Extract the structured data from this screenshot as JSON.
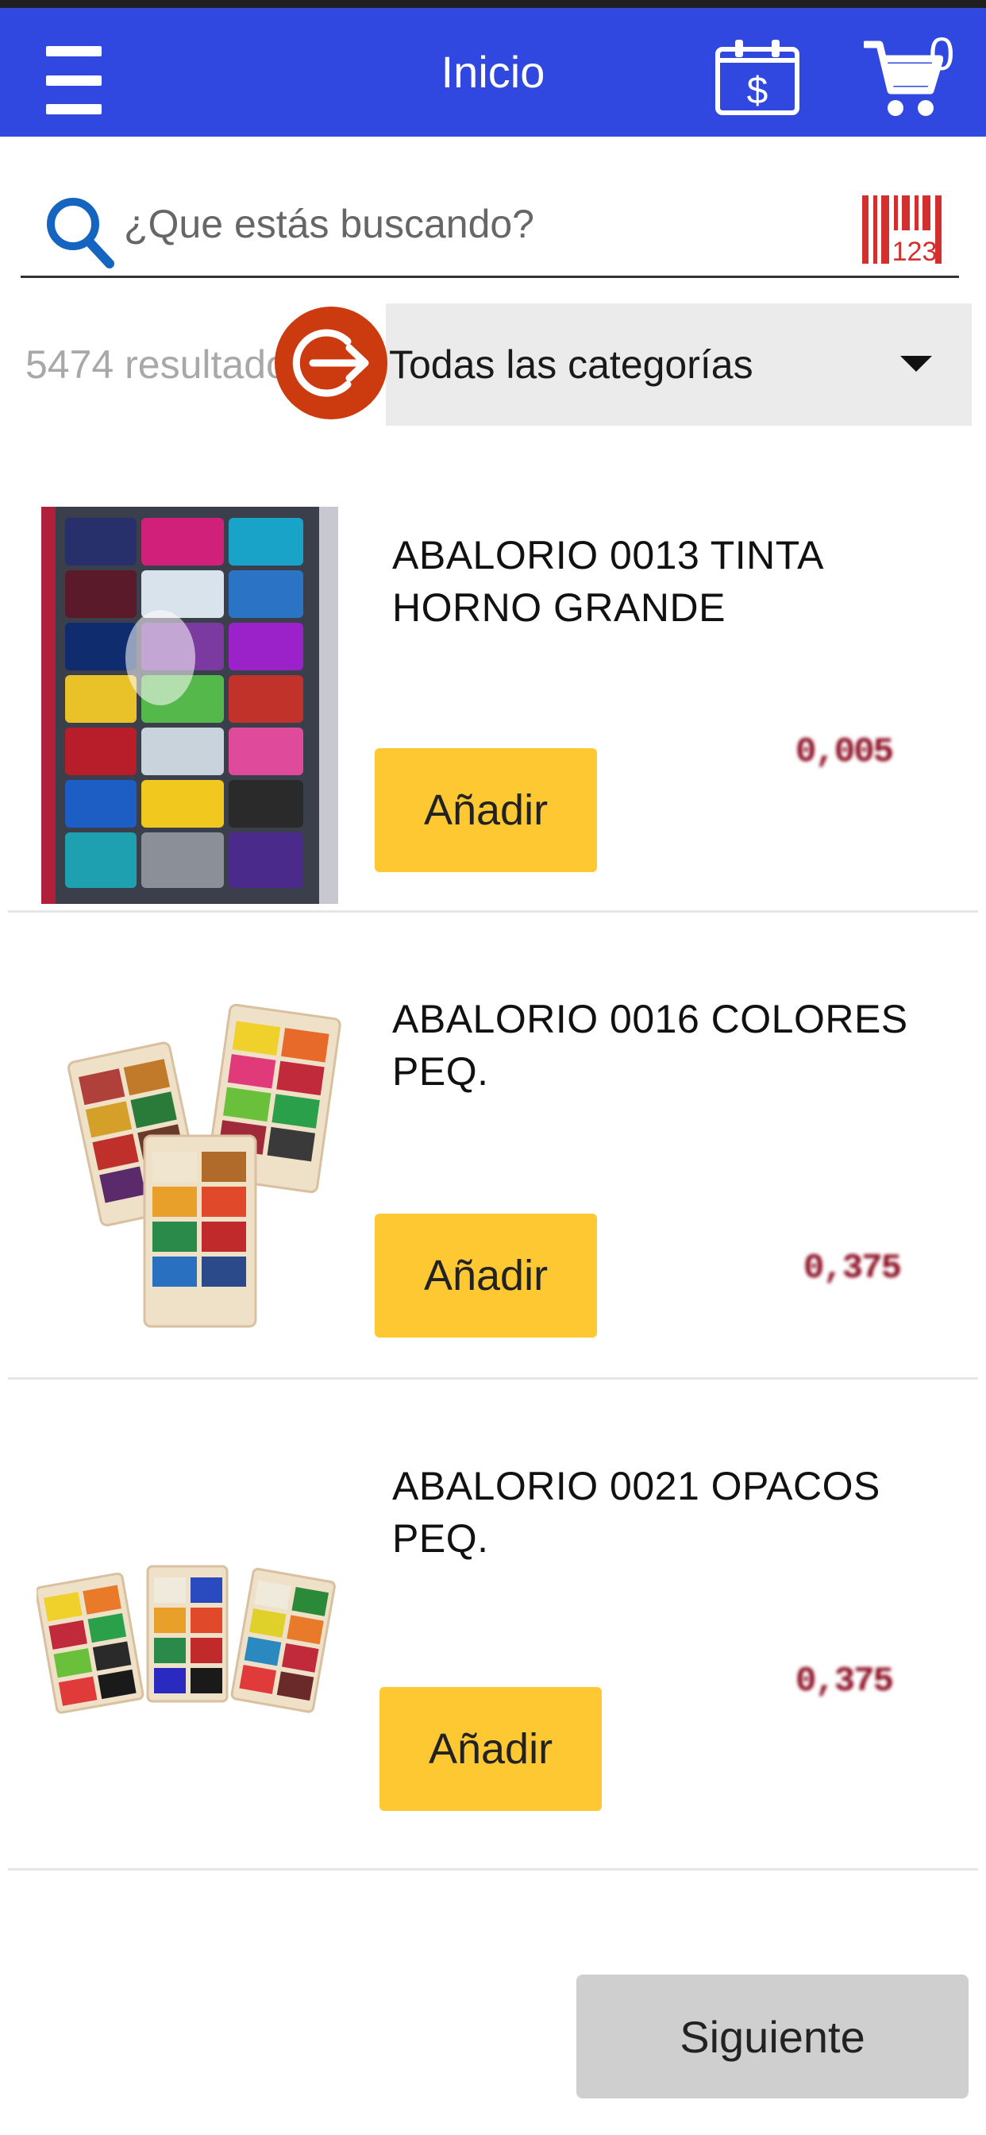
{
  "header": {
    "title": "Inicio",
    "menu_icon": "hamburger-menu-icon",
    "calendar_icon": "calendar-dollar-icon",
    "cart_icon": "shopping-cart-icon",
    "cart_count": "0"
  },
  "search": {
    "placeholder": "¿Que estás buscando?",
    "value": "",
    "search_icon": "search-icon",
    "barcode_icon": "barcode-scanner-icon",
    "barcode_text": "123"
  },
  "filters": {
    "results_text": "5474 resultados",
    "go_icon": "arrow-right-circle-icon",
    "category_selected": "Todas las categorías"
  },
  "products": [
    {
      "name": "ABALORIO 0013 TINTA HORNO GRANDE",
      "price": "0,005",
      "add_label": "Añadir"
    },
    {
      "name": "ABALORIO 0016 COLORES PEQ.",
      "price": "0,375",
      "add_label": "Añadir"
    },
    {
      "name": "ABALORIO 0021 OPACOS PEQ.",
      "price": "0,375",
      "add_label": "Añadir"
    }
  ],
  "pagination": {
    "next_label": "Siguiente"
  },
  "colors": {
    "app_bar": "#3047e0",
    "search_icon": "#1565c0",
    "barcode_icon": "#d32f2f",
    "go_button": "#cc3b10",
    "add_button": "#fdc832",
    "price": "#8c0d22",
    "next_button": "#cfcfcf"
  }
}
